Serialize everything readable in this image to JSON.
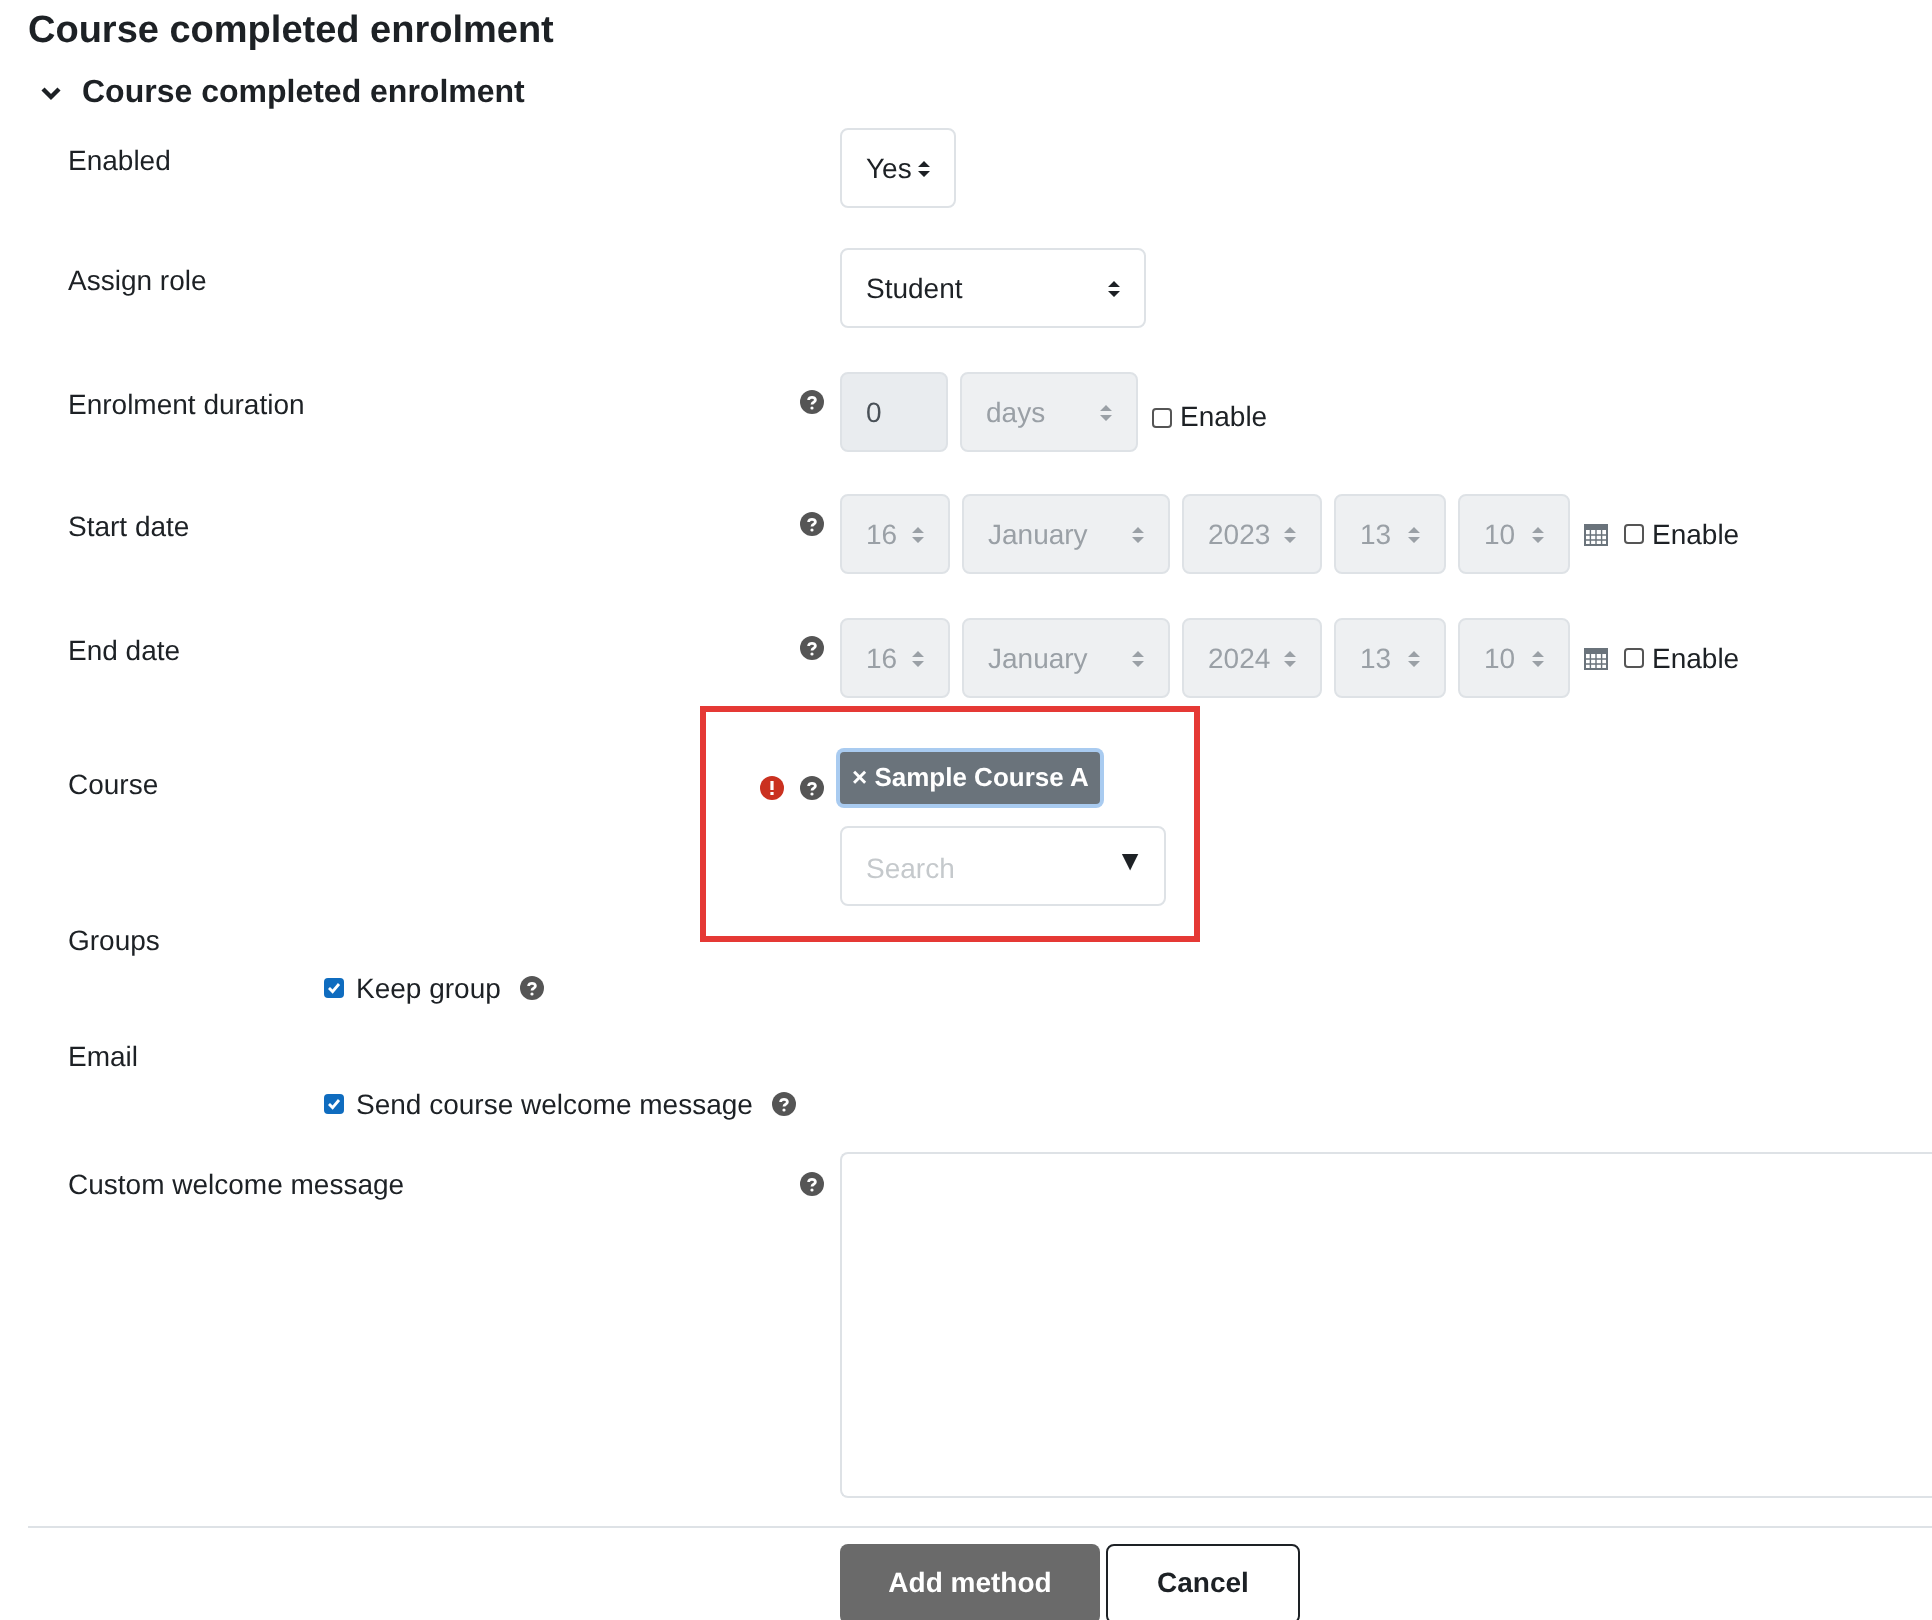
{
  "page_title": "Course completed enrolment",
  "section": {
    "title": "Course completed enrolment",
    "expanded": true
  },
  "fields": [
    {
      "kind": "select",
      "label": "Enabled",
      "value": "Yes"
    },
    {
      "kind": "select",
      "label": "Assign role",
      "value": "Student"
    },
    {
      "kind": "duration",
      "label": "Enrolment duration",
      "help": true,
      "number": "0",
      "unit": "days",
      "disabled": true,
      "enable_label": "Enable",
      "enable_checked": false
    },
    {
      "kind": "date",
      "label": "Start date",
      "help": true,
      "parts": [
        "16",
        "January",
        "2023",
        "13",
        "10"
      ],
      "disabled": true,
      "enable_label": "Enable",
      "enable_checked": false
    },
    {
      "kind": "date",
      "label": "End date",
      "help": true,
      "parts": [
        "16",
        "January",
        "2024",
        "13",
        "10"
      ],
      "disabled": true,
      "enable_label": "Enable",
      "enable_checked": false
    },
    {
      "kind": "autocomplete",
      "label": "Course",
      "help": true,
      "required_error": true,
      "highlighted": true,
      "tags": [
        "× Sample Course A"
      ],
      "placeholder": "Search",
      "arrow": "▼"
    },
    {
      "kind": "checkbox",
      "label": "Groups",
      "option": "Keep group",
      "checked": true,
      "help": true
    },
    {
      "kind": "checkbox",
      "label": "Email",
      "option": "Send course welcome message",
      "checked": true,
      "help": true
    },
    {
      "kind": "textarea",
      "label": "Custom welcome message",
      "help": true
    }
  ],
  "buttons": [
    {
      "label": "Add method",
      "primary": true
    },
    {
      "label": "Cancel",
      "primary": false
    }
  ]
}
